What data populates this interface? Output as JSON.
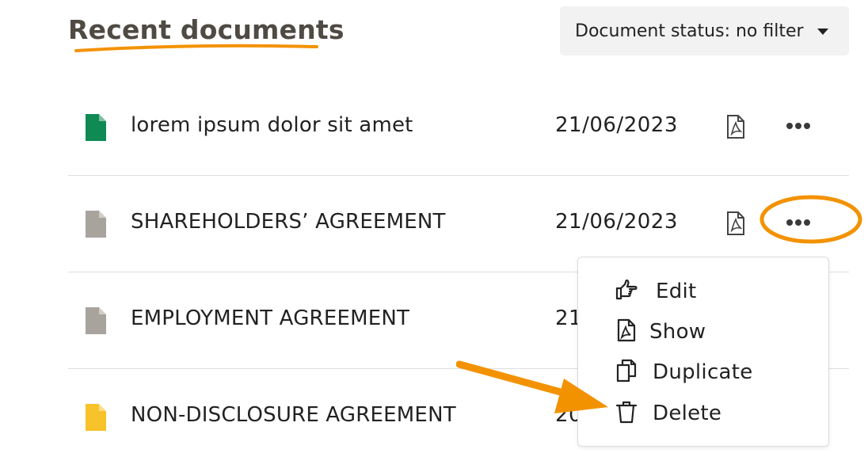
{
  "header": {
    "title": "Recent documents",
    "filter_label": "Document status: no filter"
  },
  "documents": [
    {
      "name": "lorem ipsum dolor sit amet",
      "date": "21/06/2023",
      "icon_color": "#0f8a55"
    },
    {
      "name": "SHAREHOLDERS’ AGREEMENT",
      "date": "21/06/2023",
      "icon_color": "#a8a39d"
    },
    {
      "name": "EMPLOYMENT AGREEMENT",
      "date": "21",
      "icon_color": "#a8a39d"
    },
    {
      "name": "NON-DISCLOSURE AGREEMENT",
      "date": "20",
      "icon_color": "#f7c22a"
    }
  ],
  "context_menu": {
    "items": [
      {
        "label": "Edit",
        "icon": "pointing-hand-icon"
      },
      {
        "label": "Show",
        "icon": "pdf-file-icon"
      },
      {
        "label": "Duplicate",
        "icon": "copy-icon"
      },
      {
        "label": "Delete",
        "icon": "trash-icon"
      }
    ]
  },
  "colors": {
    "accent": "#f39200",
    "title": "#4f4a43",
    "dropdown_bg": "#f2f2f2"
  }
}
